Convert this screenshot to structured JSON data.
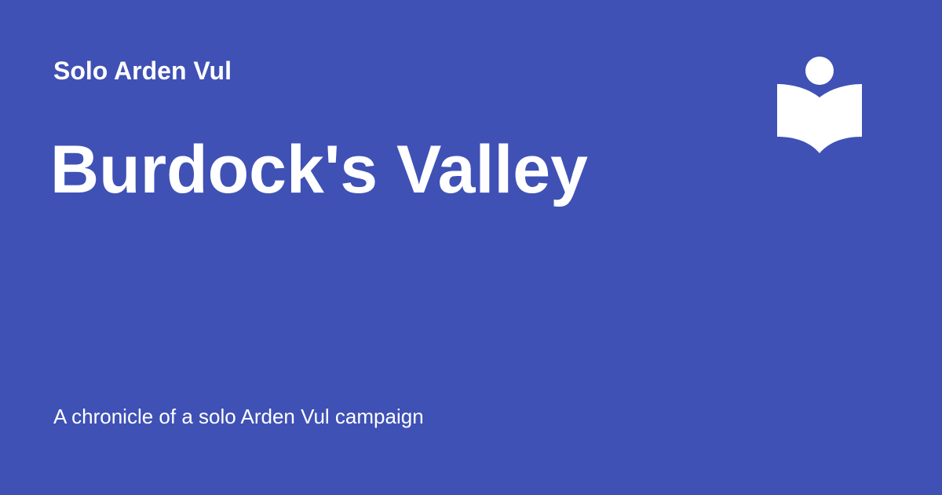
{
  "site": {
    "name": "Solo Arden Vul"
  },
  "page": {
    "title": "Burdock's Valley",
    "description": "A chronicle of a solo Arden Vul campaign"
  },
  "logo": {
    "icon": "reader-book-icon",
    "color": "#ffffff"
  },
  "theme": {
    "background": "#3f51b5",
    "text": "#ffffff"
  }
}
